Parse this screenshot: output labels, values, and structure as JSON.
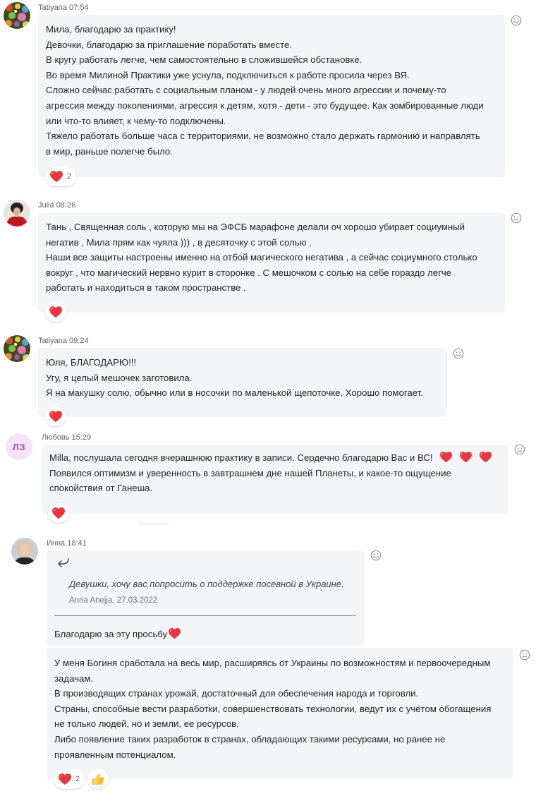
{
  "messages": [
    {
      "author": "Tatiyana",
      "time": "07:54",
      "lines": [
        "Мила, благодарю за практику!",
        "Девочки, благодарю за приглашение поработать вместе.",
        "В кругу работать легче, чем самостоятельно в сложившейся обстановке.",
        "Во время Милиной Практики уже уснула, подключиться к работе просила через ВЯ.",
        "Сложно сейчас работать с социальным планом - у людей очень много агрессии и почему-то",
        "агрессия между поколениями, агрессия к детям, хотя - дети - это будущее. Как зомбированные люди",
        "или что-то влияет, к чему-то подключены.",
        "Тяжело работать больше часа с территориями, не возможно стало держать гармонию и направлять",
        "в мир, раньше полегче было."
      ],
      "reaction": {
        "icon": "heart",
        "count": "2"
      }
    },
    {
      "author": "Julia",
      "time": "08:26",
      "lines": [
        "Тань , Священная соль , которую мы на ЭФСБ марафоне делали оч хорошо убирает социумный",
        "негатив , Мила прям как чуяла ))) , в десяточку с этой солью .",
        "Наши все защиты настроены именно на отбой магического негатива , а сейчас социумного столько",
        "вокруг , что магический нервно курит в сторонке . С мешочком с солью на себе гораздо легче",
        "работать и находиться в таком пространстве ."
      ],
      "reaction": {
        "icon": "heart",
        "count": ""
      }
    },
    {
      "author": "Tatiyana",
      "time": "09:24",
      "lines": [
        "Юля, БЛАГОДАРЮ!!!",
        "Угу, я целый мешочек заготовила.",
        "Я на макушку солю, обычно или в носочки по маленькой щепоточке. Хорошо помогает."
      ],
      "reaction": {
        "icon": "heart",
        "count": ""
      }
    },
    {
      "author": "Любовь",
      "time": "15:29",
      "initials": "ЛЗ",
      "lines": [
        "Milla, послушала сегодня вчерашнюю практику в записи. Сердечно благодарю Вас и ВС!",
        "Появился оптимизм и уверенность в завтрашнем дне нашей Планеты, и какое-то ощущение",
        "спокойствия от Ганеша."
      ],
      "reaction": {
        "icon": "heart",
        "count": ""
      }
    },
    {
      "author": "Инна",
      "time": "18:41",
      "quote": {
        "text": "Девушки, хочу вас попросить о поддержке посевной в Украине.",
        "author": "Anna Anejja, 27.03.2022"
      },
      "reply": "Благодарю за эту просьбу",
      "lines": [
        "У меня Богиня сработала на весь мир, расширяясь от Украины по возможностям и первоочередным",
        "задачам.",
        "В производящих странах урожай, достаточный для обеспечения народа и торговли.",
        "Страны, способные вести разработки, совершенствовать технологии, ведут их с учётом обогащения",
        "не только людей, но и земли, ее ресурсов.",
        "Либо появление таких разработок в странах, обладающих такими ресурсами, но ранее не",
        "проявленным потенциалом."
      ],
      "reaction": {
        "icon": "heart",
        "count": "2"
      },
      "reaction2": {
        "icon": "thumbs-up",
        "count": ""
      }
    }
  ],
  "colors": {
    "bubble": "#f3f5f8",
    "heart": "#e8363c",
    "initials_bg": "#f3e4f5",
    "initials_fg": "#b146c2"
  }
}
